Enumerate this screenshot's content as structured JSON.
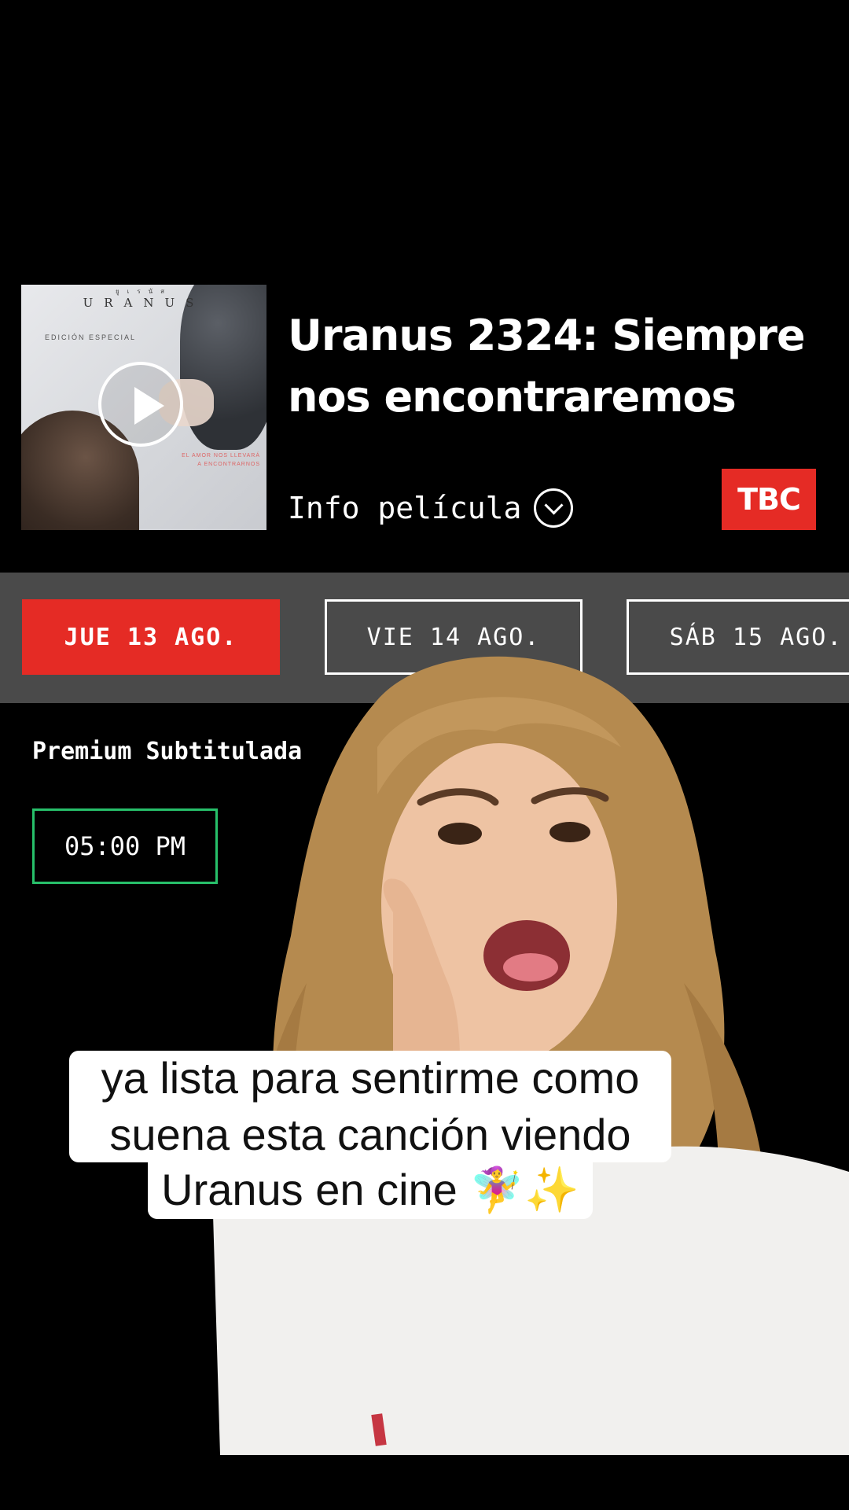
{
  "movie": {
    "title": "Uranus 2324: Siempre nos encontraremos",
    "info_label": "Info película",
    "rating": "TBC",
    "poster": {
      "brand": "URANUS",
      "brand_top": "ยูเรนัส",
      "edition": "EDICIÓN ESPECIAL",
      "tagline": "EL AMOR NOS LLEVARÁ A ENCONTRARNOS"
    }
  },
  "dates": [
    {
      "label": "JUE 13 AGO.",
      "selected": true
    },
    {
      "label": "VIE 14 AGO.",
      "selected": false
    },
    {
      "label": "SÁB 15 AGO.",
      "selected": false
    }
  ],
  "showtimes": {
    "format": "Premium Subtitulada",
    "times": [
      "05:00 PM"
    ]
  },
  "caption": {
    "line1": "ya lista para sentirme como",
    "line2": "suena esta canción viendo",
    "line3": "Uranus en cine 🧚‍♀️✨"
  },
  "colors": {
    "accent_red": "#e52b25",
    "showtime_green": "#27c06a",
    "date_strip_bg": "#4a4a4a"
  },
  "icons": {
    "play": "play-icon",
    "info": "chevron-down-icon"
  }
}
